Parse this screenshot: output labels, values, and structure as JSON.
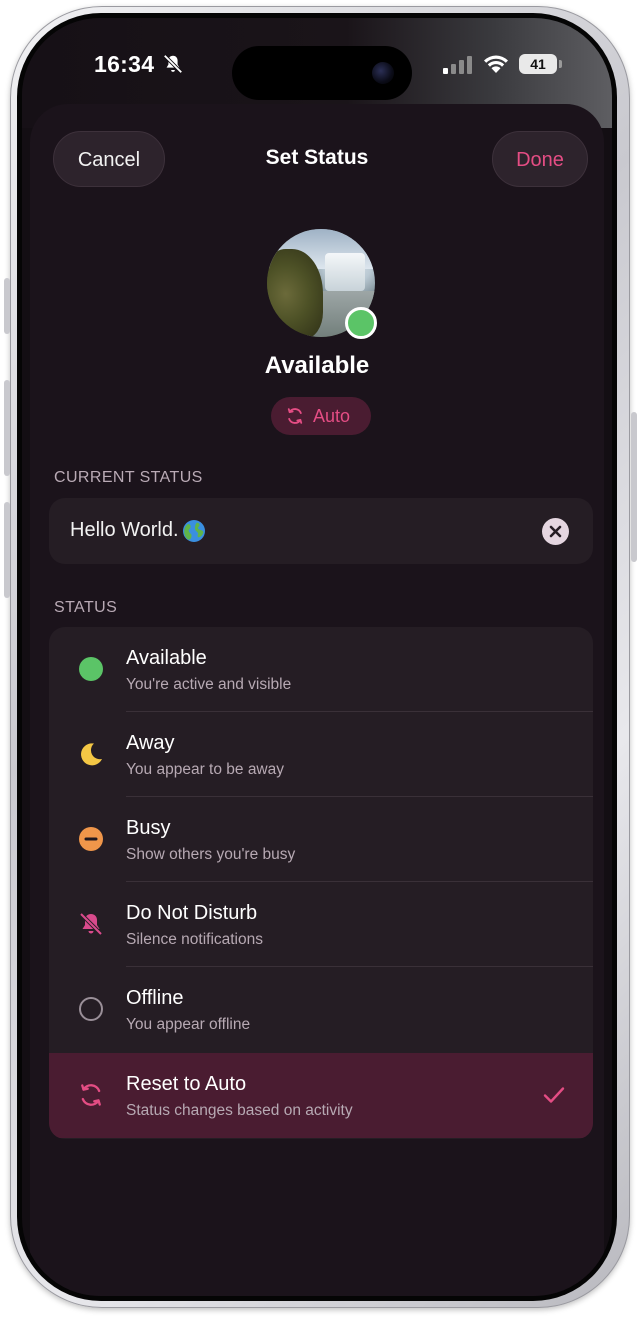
{
  "status_bar": {
    "time": "16:34",
    "battery": "41"
  },
  "sheet": {
    "title": "Set Status",
    "cancel_label": "Cancel",
    "done_label": "Done"
  },
  "profile": {
    "name": "Available",
    "auto_label": "Auto",
    "presence_color": "#5bc467"
  },
  "current_status": {
    "header": "CURRENT STATUS",
    "text": "Hello World.",
    "emoji_icon": "globe-icon"
  },
  "status": {
    "header": "STATUS",
    "options": [
      {
        "title": "Available",
        "subtitle": "You're active and visible",
        "icon": "green-dot-icon",
        "color": "#5bc467"
      },
      {
        "title": "Away",
        "subtitle": "You appear to be away",
        "icon": "moon-icon",
        "color": "#f4c745"
      },
      {
        "title": "Busy",
        "subtitle": "Show others you're busy",
        "icon": "minus-circle-icon",
        "color": "#f0964a"
      },
      {
        "title": "Do Not Disturb",
        "subtitle": "Silence notifications",
        "icon": "bell-slash-icon",
        "color": "#d94a8c"
      },
      {
        "title": "Offline",
        "subtitle": "You appear offline",
        "icon": "empty-circle-icon",
        "color": "#9a8f98"
      },
      {
        "title": "Reset to Auto",
        "subtitle": "Status changes based on activity",
        "icon": "refresh-icon",
        "color": "#e44d84",
        "selected": true
      }
    ]
  },
  "colors": {
    "accent": "#e44d84",
    "sheet_bg": "#1b131b",
    "card_bg": "#251d24",
    "selected_bg": "#4a1c31"
  }
}
